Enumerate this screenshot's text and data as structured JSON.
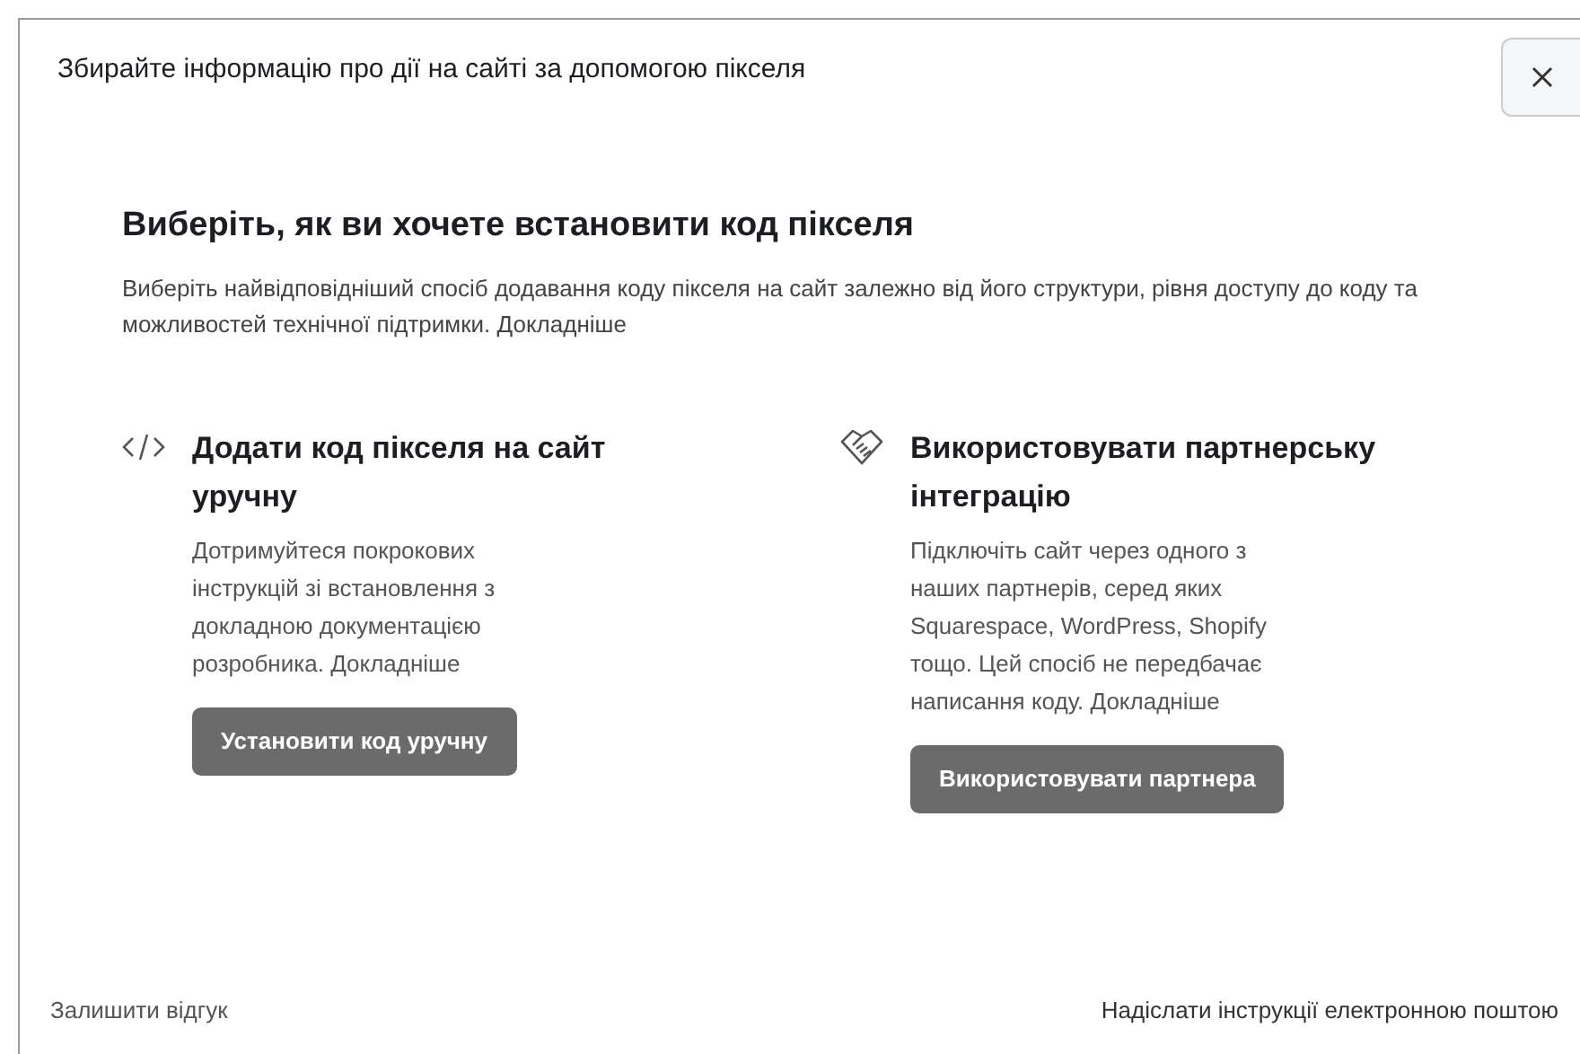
{
  "dialog": {
    "title": "Збирайте інформацію про дії на сайті за допомогою пікселя",
    "heading": "Виберіть, як ви хочете встановити код пікселя",
    "description": "Виберіть найвідповідніший спосіб додавання коду пікселя на сайт залежно від його структури, рівня доступу до коду та можливостей технічної підтримки.",
    "description_link": "Докладніше",
    "options": [
      {
        "kind": "code",
        "title": "Додати код пікселя на сайт уручну",
        "text": "Дотримуйтеся покрокових інструкцій зі встановлення з докладною документацією розробника.",
        "link": "Докладніше",
        "button": "Установити код уручну"
      },
      {
        "kind": "partner",
        "title": "Використовувати партнерську інтеграцію",
        "text": "Підключіть сайт через одного з наших партнерів, серед яких Squarespace, WordPress, Shopify тощо. Цей спосіб не передбачає написання коду.",
        "link": "Докладніше",
        "button": "Використовувати партнера"
      }
    ],
    "footer_left": "Залишити відгук",
    "footer_right": "Надіслати інструкції електронною поштою"
  }
}
